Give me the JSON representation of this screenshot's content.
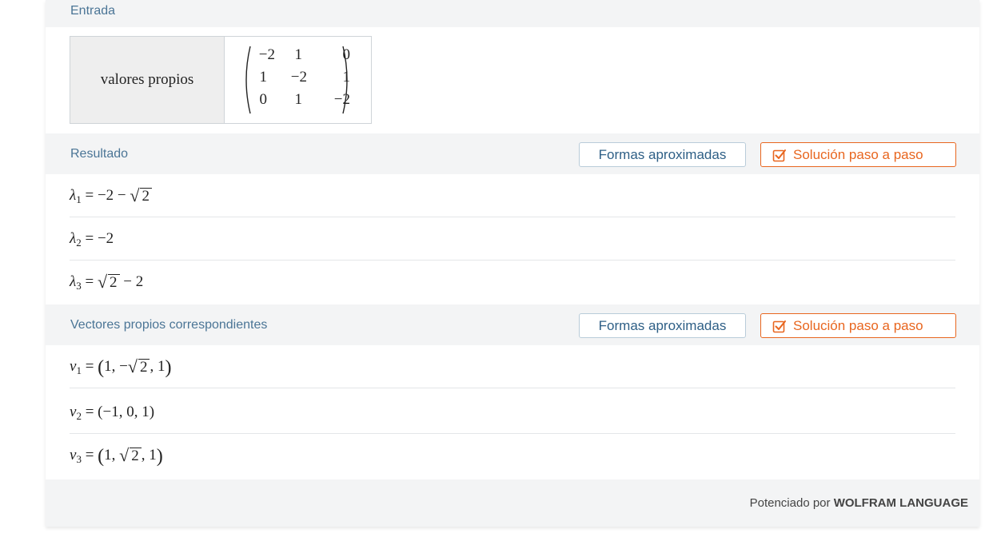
{
  "input": {
    "title": "Entrada",
    "label": "valores propios",
    "matrix": [
      [
        "−2",
        "1",
        "0"
      ],
      [
        "1",
        "−2",
        "1"
      ],
      [
        "0",
        "1",
        "−2"
      ]
    ]
  },
  "result": {
    "title": "Resultado",
    "approx_button": "Formas aproximadas",
    "steps_button": "Solución paso a paso",
    "rows": [
      {
        "sym": "λ",
        "sub": "1",
        "eq": " = −2 − ",
        "sqrt": "2",
        "tail": ""
      },
      {
        "sym": "λ",
        "sub": "2",
        "eq": " = −2",
        "sqrt": "",
        "tail": ""
      },
      {
        "sym": "λ",
        "sub": "3",
        "eq": " = ",
        "sqrt": "2",
        "tail": " − 2"
      }
    ]
  },
  "vectors": {
    "title": "Vectores propios correspondientes",
    "approx_button": "Formas aproximadas",
    "steps_button": "Solución paso a paso",
    "rows": [
      {
        "sym": "v",
        "sub": "1",
        "eq": " = ",
        "pre": "1, −",
        "sqrt": "2",
        "post": ", 1"
      },
      {
        "sym": "v",
        "sub": "2",
        "eq": " = ",
        "pre": "−1, 0, 1",
        "sqrt": "",
        "post": ""
      },
      {
        "sym": "v",
        "sub": "3",
        "eq": " = ",
        "pre": "1, ",
        "sqrt": "2",
        "post": ", 1"
      }
    ]
  },
  "footer": {
    "prefix": "Potenciado por ",
    "brand": "WOLFRAM LANGUAGE"
  },
  "colors": {
    "pod_title": "#4b7596",
    "accent_orange": "#e8661f",
    "approx_border": "#b9ccd9",
    "band": "#f3f4f5"
  }
}
